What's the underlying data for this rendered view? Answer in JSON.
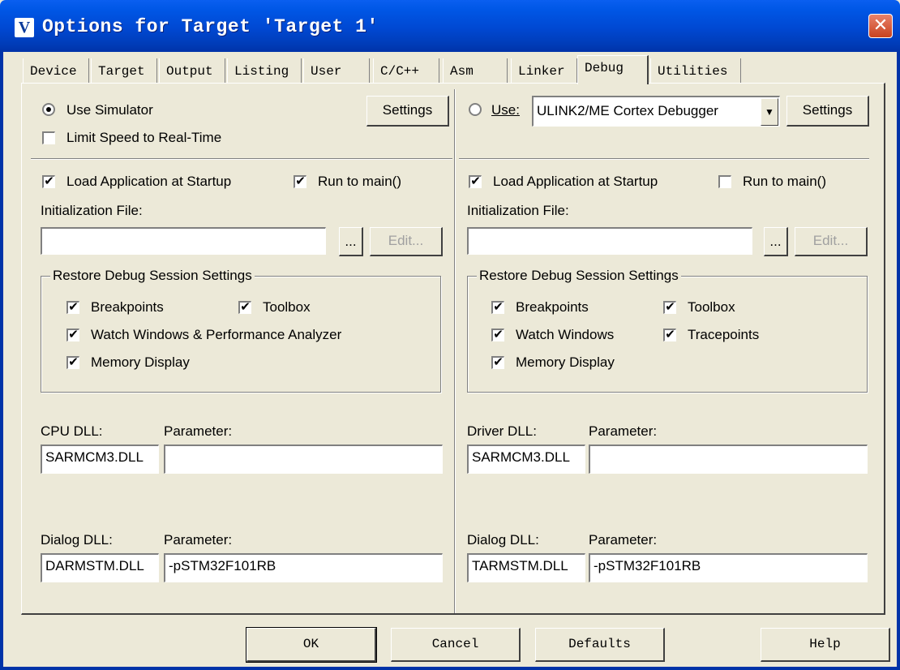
{
  "window": {
    "title": "Options for Target 'Target 1'",
    "app_icon": "V",
    "close": "✕"
  },
  "tabs": [
    "Device",
    "Target",
    "Output",
    "Listing",
    "User",
    "C/C++",
    "Asm",
    "Linker",
    "Debug",
    "Utilities"
  ],
  "active_tab": "Debug",
  "left": {
    "use_simulator": "Use Simulator",
    "use_simulator_checked": true,
    "settings": "Settings",
    "limit_speed": "Limit Speed to Real-Time",
    "limit_speed_checked": false,
    "load_app": "Load Application at Startup",
    "run_main": "Run to main()",
    "init_file_label": "Initialization File:",
    "init_file_value": "",
    "browse": "...",
    "edit": "Edit...",
    "restore_group": "Restore Debug Session Settings",
    "breakpoints": "Breakpoints",
    "toolbox": "Toolbox",
    "watch_windows": "Watch Windows & Performance Analyzer",
    "memory_display": "Memory Display",
    "cpu_dll_label": "CPU DLL:",
    "parameter_label": "Parameter:",
    "cpu_dll": "SARMCM3.DLL",
    "cpu_param": "",
    "dialog_dll_label": "Dialog DLL:",
    "dialog_dll": "DARMSTM.DLL",
    "dialog_param": "-pSTM32F101RB"
  },
  "right": {
    "use": "Use:",
    "use_checked": false,
    "debugger": "ULINK2/ME Cortex Debugger",
    "settings": "Settings",
    "load_app": "Load Application at Startup",
    "run_main": "Run to main()",
    "init_file_label": "Initialization File:",
    "init_file_value": "",
    "browse": "...",
    "edit": "Edit...",
    "restore_group": "Restore Debug Session Settings",
    "breakpoints": "Breakpoints",
    "toolbox": "Toolbox",
    "watch_windows": "Watch Windows",
    "tracepoints": "Tracepoints",
    "memory_display": "Memory Display",
    "driver_dll_label": "Driver DLL:",
    "parameter_label": "Parameter:",
    "driver_dll": "SARMCM3.DLL",
    "driver_param": "",
    "dialog_dll_label": "Dialog DLL:",
    "dialog_dll": "TARMSTM.DLL",
    "dialog_param": "-pSTM32F101RB"
  },
  "footer": {
    "ok": "OK",
    "cancel": "Cancel",
    "defaults": "Defaults",
    "help": "Help"
  },
  "check_glyph": "✔"
}
